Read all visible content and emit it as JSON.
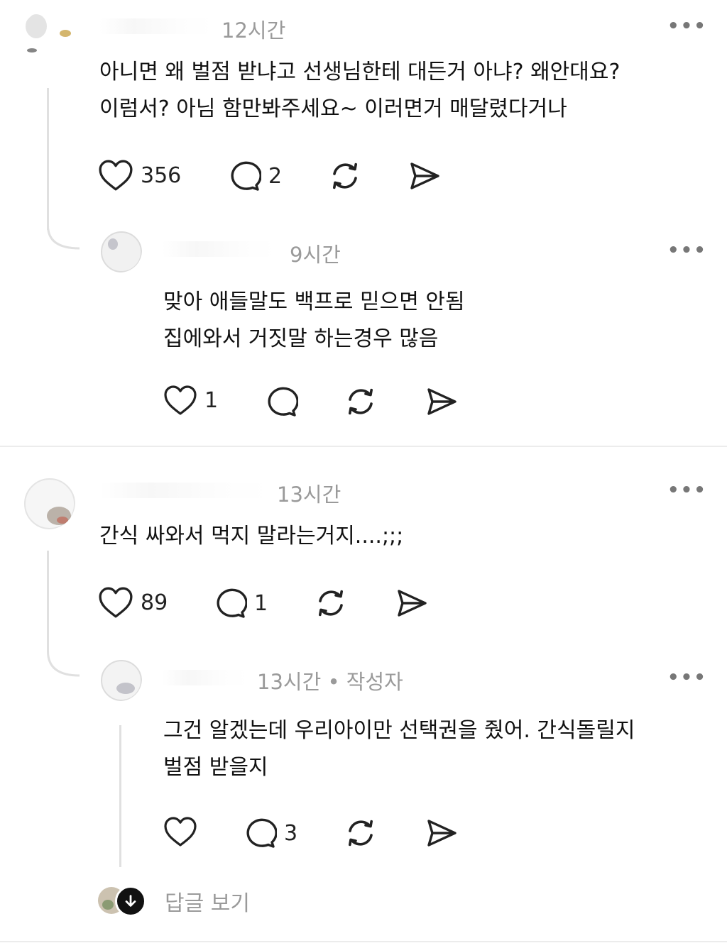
{
  "comments": [
    {
      "time": "12시간",
      "text": "아니면 왜 벌점 받냐고 선생님한테 대든거 아냐? 왜안대요?\n이럼서?  아님 함만봐주세요~ 이러면거 매달렸다거나",
      "likes": "356",
      "replies": "2",
      "reply": {
        "time": "9시간",
        "text": "맞아 애들말도 백프로 믿으면 안됨\n집에와서 거짓말 하는경우 많음",
        "likes": "1"
      }
    },
    {
      "time": "13시간",
      "text": "간식 싸와서 먹지 말라는거지....;;;",
      "likes": "89",
      "replies": "1",
      "reply": {
        "time": "13시간 • 작성자",
        "text": "그건 알겠는데 우리아이만 선택권을 줬어. 간식돌릴지\n벌점 받을지",
        "replies": "3"
      }
    }
  ],
  "more_label": "•••",
  "view_replies_label": "답글 보기",
  "icons": [
    "heart-icon",
    "comment-icon",
    "repost-icon",
    "share-icon",
    "arrow-down-icon"
  ],
  "colors": {
    "meta": "#9a9a9a",
    "text": "#111111",
    "icon": "#222222",
    "line": "#e0e0e0"
  }
}
